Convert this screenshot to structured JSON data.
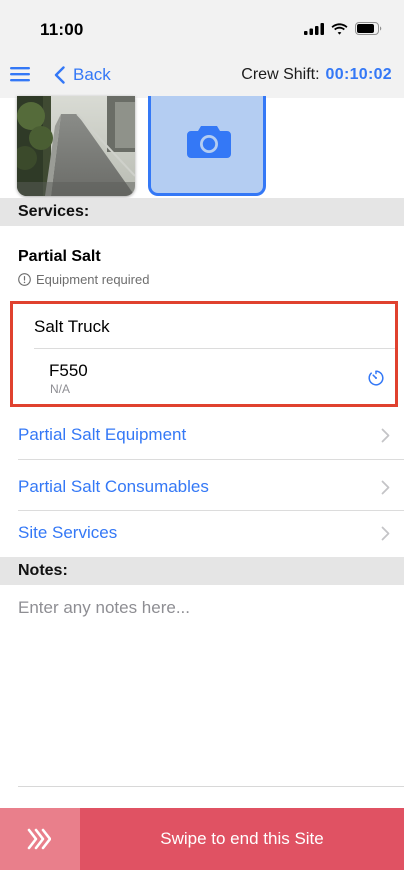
{
  "status_bar": {
    "time": "11:00"
  },
  "nav": {
    "back_label": "Back",
    "crew_shift_label": "Crew Shift:",
    "crew_shift_timer": "00:10:02"
  },
  "photos": {
    "add_icon": "camera-icon"
  },
  "services": {
    "header": "Services:",
    "service_name": "Partial Salt",
    "warning": "Equipment required",
    "equipment_group": "Salt Truck",
    "equipment_item": {
      "name": "F550",
      "detail": "N/A"
    },
    "links": [
      {
        "label": "Partial Salt Equipment"
      },
      {
        "label": "Partial Salt Consumables"
      },
      {
        "label": "Site Services"
      }
    ]
  },
  "notes": {
    "header": "Notes:",
    "placeholder": "Enter any notes here..."
  },
  "swipe": {
    "label": "Swipe to end this Site"
  },
  "colors": {
    "accent": "#3478f6",
    "highlight_border": "#e0412f",
    "swipe_bg": "#e05263",
    "swipe_handle": "#e97f8b"
  }
}
